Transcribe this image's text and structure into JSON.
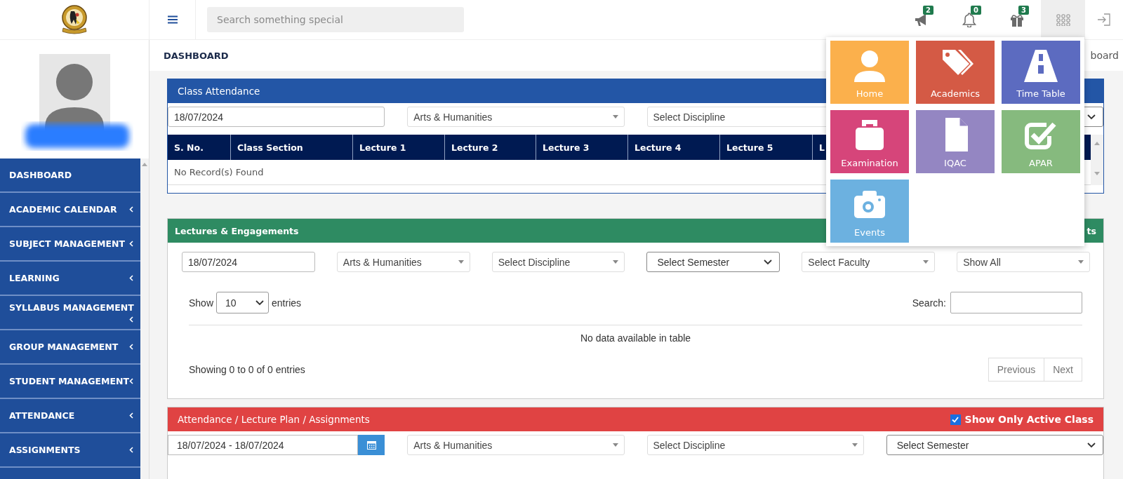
{
  "header": {
    "search": {
      "placeholder": "Search something special"
    },
    "notifications": [
      {
        "kind": "megaphone",
        "count": "2"
      },
      {
        "kind": "bell",
        "count": "0"
      },
      {
        "kind": "gift",
        "count": "3"
      }
    ],
    "apps_menu": {
      "expanded": true
    }
  },
  "apps": [
    {
      "label": "Home",
      "kind": "user",
      "color": "#fbb04c"
    },
    {
      "label": "Academics",
      "kind": "tags",
      "color": "#d45a45"
    },
    {
      "label": "Time Table",
      "kind": "road",
      "color": "#5c6bc0"
    },
    {
      "label": "Examination",
      "kind": "bag",
      "color": "#d6457a"
    },
    {
      "label": "IQAC",
      "kind": "file",
      "color": "#9486c2"
    },
    {
      "label": "APAR",
      "kind": "check",
      "color": "#86ba7e"
    },
    {
      "label": "Events",
      "kind": "camera",
      "color": "#6cb1e0"
    }
  ],
  "sidebar": {
    "items": [
      {
        "label": "DASHBOARD",
        "submenu": false
      },
      {
        "label": "ACADEMIC CALENDAR",
        "submenu": true
      },
      {
        "label": "SUBJECT MANAGEMENT",
        "submenu": true
      },
      {
        "label": "LEARNING",
        "submenu": true
      },
      {
        "label": "SYLLABUS MANAGEMENT",
        "submenu": true
      },
      {
        "label": "GROUP MANAGEMENT",
        "submenu": true
      },
      {
        "label": "STUDENT MANAGEMENT",
        "submenu": true
      },
      {
        "label": "ATTENDANCE",
        "submenu": true
      },
      {
        "label": "ASSIGNMENTS",
        "submenu": true
      }
    ]
  },
  "breadcrumb": {
    "title": "DASHBOARD",
    "trail": "board"
  },
  "class_attendance": {
    "title": "Class Attendance",
    "filters": [
      {
        "kind": "input",
        "value": "18/07/2024"
      },
      {
        "kind": "combo",
        "value": "Arts & Humanities"
      },
      {
        "kind": "combo",
        "value": "Select Discipline"
      },
      {
        "kind": "select"
      }
    ],
    "columns": [
      "S. No.",
      "Class Section",
      "Lecture 1",
      "Lecture 2",
      "Lecture 3",
      "Lecture 4",
      "Lecture 5",
      "L"
    ],
    "empty_message": "No Record(s) Found"
  },
  "lectures": {
    "title": "Lectures & Engagements",
    "title_right": "ts",
    "filters": [
      {
        "kind": "input",
        "value": "18/07/2024"
      },
      {
        "kind": "combo",
        "value": "Arts & Humanities"
      },
      {
        "kind": "combo",
        "value": "Select Discipline"
      },
      {
        "kind": "select",
        "value": "Select Semester"
      },
      {
        "kind": "combo",
        "value": "Select Faculty"
      },
      {
        "kind": "combo",
        "value": "Show All"
      }
    ],
    "show_label": "Show",
    "page_size": "10",
    "entries_label": "entries",
    "search_label": "Search:",
    "empty_message": "No data available in table",
    "info": "Showing 0 to 0 of 0 entries",
    "pager": [
      "Previous",
      "Next"
    ]
  },
  "assignments": {
    "title": "Attendance / Lecture Plan / Assignments",
    "active_only": {
      "label": "Show Only Active Class",
      "checked": true
    },
    "filters": [
      {
        "kind": "daterange",
        "value": "18/07/2024 - 18/07/2024"
      },
      {
        "kind": "combo",
        "value": "Arts & Humanities"
      },
      {
        "kind": "combo",
        "value": "Select Discipline"
      },
      {
        "kind": "select",
        "value": "Select Semester"
      }
    ]
  }
}
